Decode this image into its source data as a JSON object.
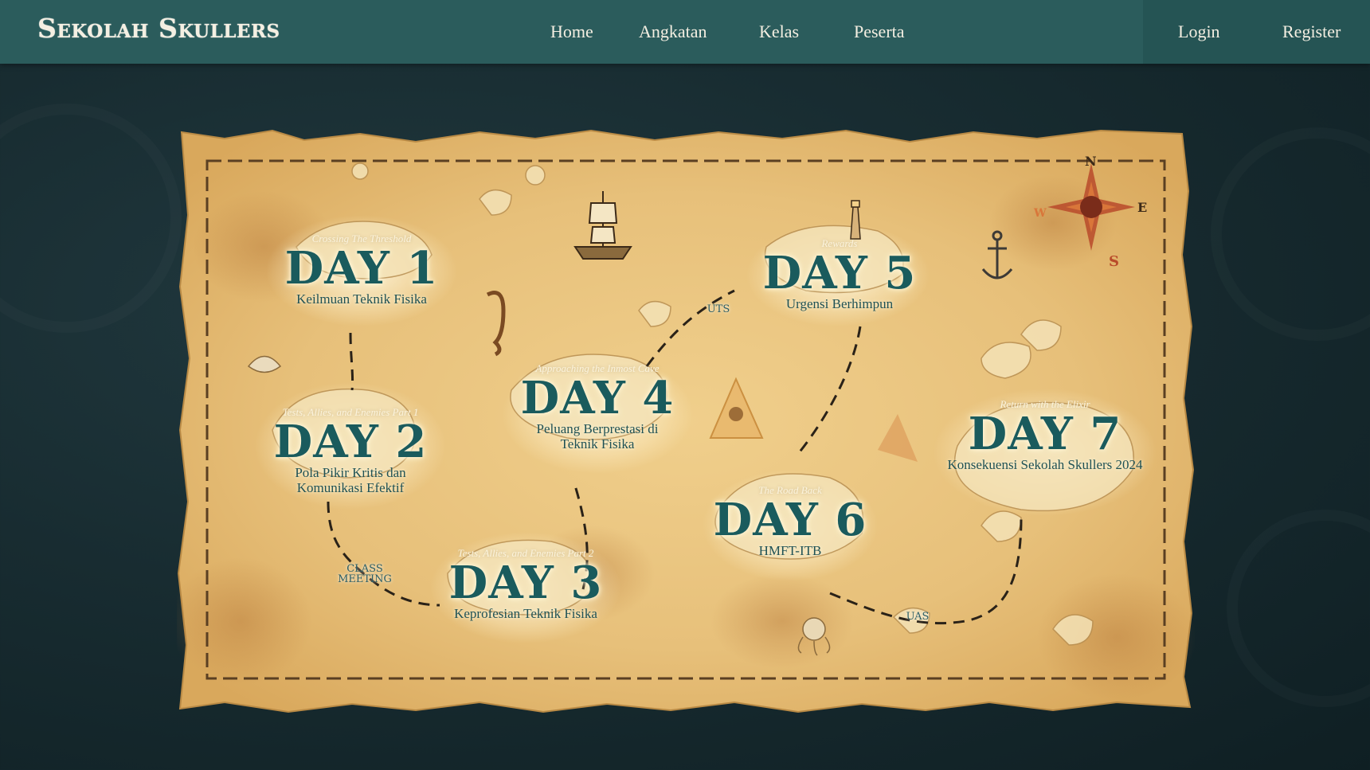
{
  "brand": {
    "logo_text": "Sekolah Skullers"
  },
  "nav": {
    "links": [
      "Home",
      "Angkatan",
      "Kelas",
      "Peserta"
    ],
    "auth": {
      "login": "Login",
      "register": "Register"
    }
  },
  "map": {
    "days": [
      {
        "arc": "Crossing The Threshold",
        "title": "DAY 1",
        "subtitle": [
          "Keilmuan Teknik Fisika"
        ]
      },
      {
        "arc": "Tests, Allies, and Enemies Part 1",
        "title": "DAY 2",
        "subtitle": [
          "Pola Pikir Kritis dan",
          "Komunikasi Efektif"
        ]
      },
      {
        "arc": "Tests, Allies, and Enemies Part 2",
        "title": "DAY 3",
        "subtitle": [
          "Keprofesian Teknik Fisika"
        ]
      },
      {
        "arc": "Approaching the Inmost Cave",
        "title": "DAY 4",
        "subtitle": [
          "Peluang Berprestasi di",
          "Teknik Fisika"
        ]
      },
      {
        "arc": "Rewards",
        "title": "DAY 5",
        "subtitle": [
          "Urgensi Berhimpun"
        ]
      },
      {
        "arc": "The Road Back",
        "title": "DAY 6",
        "subtitle": [
          "HMFT-ITB"
        ]
      },
      {
        "arc": "Return with the Elixir",
        "title": "DAY 7",
        "subtitle": [
          "Konsekuensi Sekolah Skullers 2024"
        ]
      }
    ],
    "tags": {
      "class_meeting": [
        "CLASS",
        "MEETING"
      ],
      "uts": "UTS",
      "uas": "UAS"
    },
    "compass": {
      "n": "N",
      "e": "E",
      "s": "S",
      "w": "W"
    },
    "colors": {
      "parchment": "#e7c27f",
      "ink": "#1a5b5d",
      "path": "#2a2218"
    }
  }
}
